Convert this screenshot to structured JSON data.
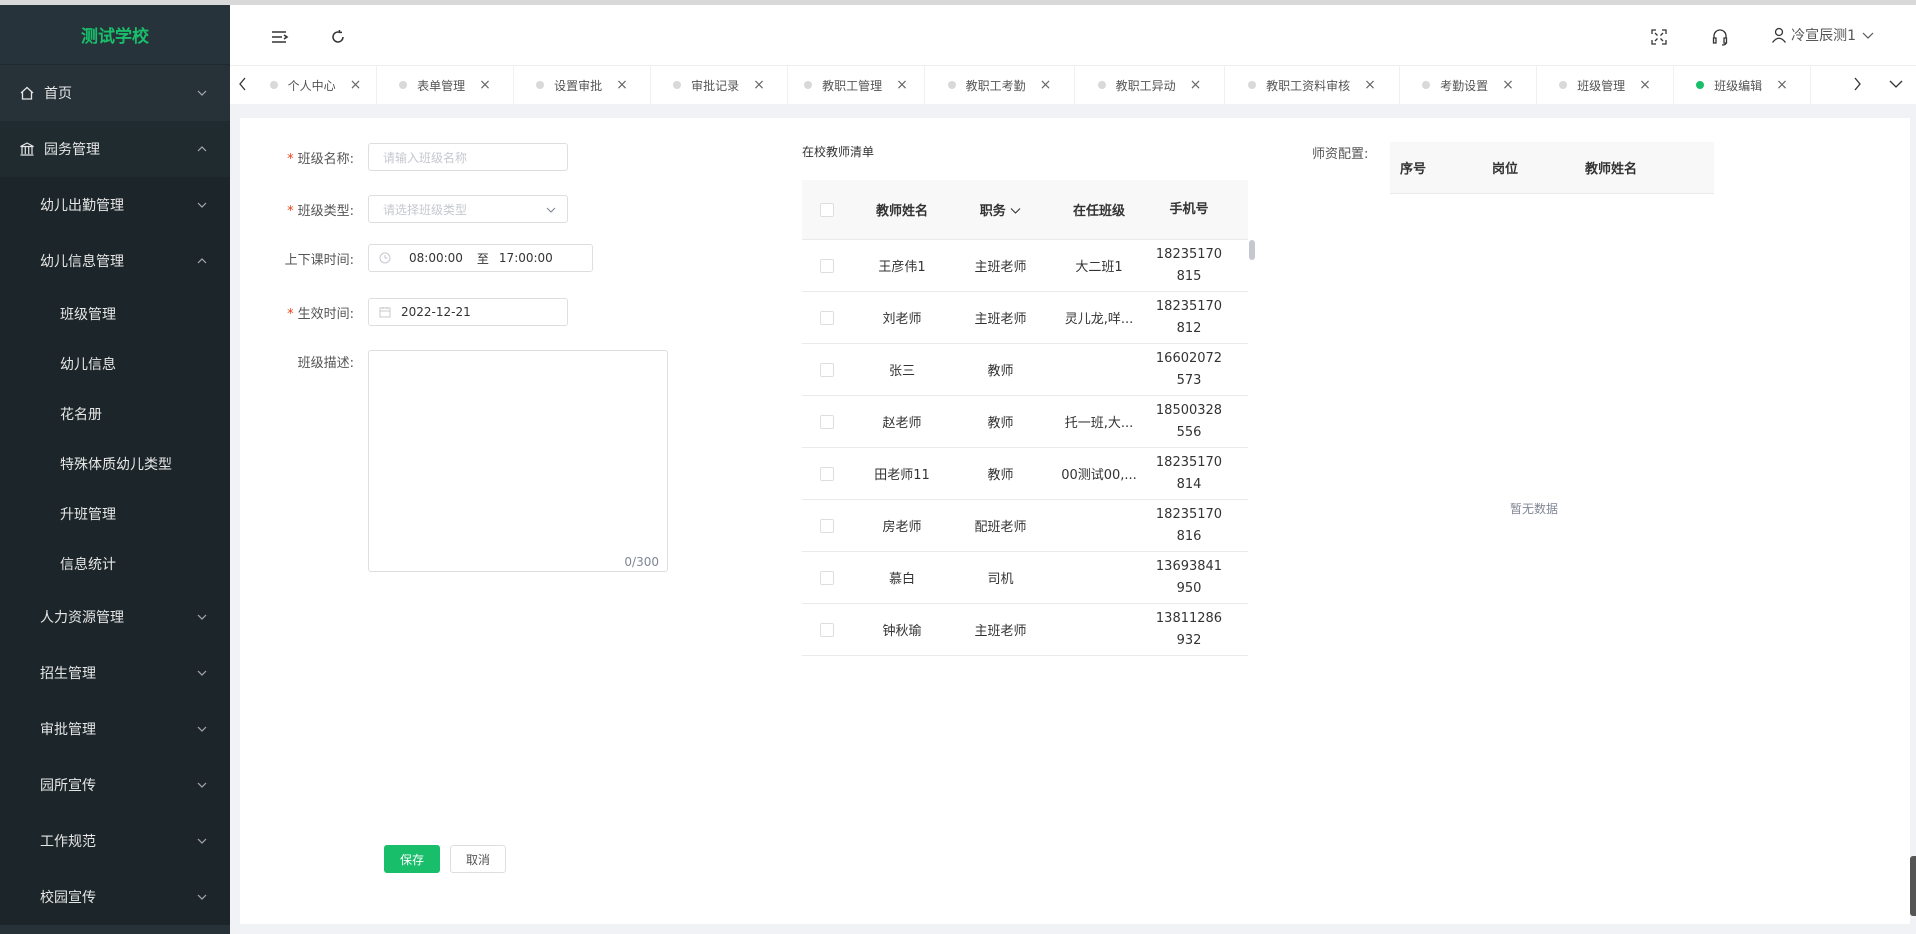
{
  "app": {
    "school_name": "测试学校"
  },
  "sidebar": {
    "items": [
      {
        "label": "首页"
      },
      {
        "label": "园务管理"
      },
      {
        "label": "幼儿出勤管理"
      },
      {
        "label": "幼儿信息管理"
      },
      {
        "label": "班级管理"
      },
      {
        "label": "幼儿信息"
      },
      {
        "label": "花名册"
      },
      {
        "label": "特殊体质幼儿类型"
      },
      {
        "label": "升班管理"
      },
      {
        "label": "信息统计"
      },
      {
        "label": "人力资源管理"
      },
      {
        "label": "招生管理"
      },
      {
        "label": "审批管理"
      },
      {
        "label": "园所宣传"
      },
      {
        "label": "工作规范"
      },
      {
        "label": "校园宣传"
      }
    ]
  },
  "header": {
    "user_name": "冷宣辰测1"
  },
  "tabs": [
    {
      "label": "个人中心"
    },
    {
      "label": "表单管理"
    },
    {
      "label": "设置审批"
    },
    {
      "label": "审批记录"
    },
    {
      "label": "教职工管理"
    },
    {
      "label": "教职工考勤"
    },
    {
      "label": "教职工异动"
    },
    {
      "label": "教职工资料审核"
    },
    {
      "label": "考勤设置"
    },
    {
      "label": "班级管理"
    },
    {
      "label": "班级编辑"
    }
  ],
  "tab_close": "×",
  "form": {
    "class_name": {
      "label": "班级名称:",
      "placeholder": "请输入班级名称"
    },
    "class_type": {
      "label": "班级类型:",
      "placeholder": "请选择班级类型"
    },
    "class_time": {
      "label": "上下课时间:",
      "start": "08:00:00",
      "sep": "至",
      "end": "17:00:00"
    },
    "effective": {
      "label": "生效时间:",
      "value": "2022-12-21"
    },
    "desc": {
      "label": "班级描述:",
      "count": "0/300"
    },
    "required_mark": "*",
    "save": "保存",
    "cancel": "取消"
  },
  "teachers": {
    "title": "在校教师清单",
    "headers": {
      "name": "教师姓名",
      "duty": "职务",
      "cls": "在任班级",
      "phone": "手机号"
    },
    "rows": [
      {
        "name": "王彦伟1",
        "duty": "主班老师",
        "cls": "大二班1",
        "phone": "18235170815"
      },
      {
        "name": "刘老师",
        "duty": "主班老师",
        "cls": "灵儿龙,咩...",
        "phone": "18235170812"
      },
      {
        "name": "张三",
        "duty": "教师",
        "cls": "",
        "phone": "16602072573"
      },
      {
        "name": "赵老师",
        "duty": "教师",
        "cls": "托一班,大...",
        "phone": "18500328556"
      },
      {
        "name": "田老师11",
        "duty": "教师",
        "cls": "00测试00,...",
        "phone": "18235170814"
      },
      {
        "name": "房老师",
        "duty": "配班老师",
        "cls": "",
        "phone": "18235170816"
      },
      {
        "name": "慕白",
        "duty": "司机",
        "cls": "",
        "phone": "13693841950"
      },
      {
        "name": "钟秋瑜",
        "duty": "主班老师",
        "cls": "",
        "phone": "13811286932"
      }
    ]
  },
  "staff": {
    "label": "师资配置:",
    "headers": {
      "no": "序号",
      "post": "岗位",
      "name": "教师姓名"
    },
    "empty": "暂无数据"
  },
  "colors": {
    "accent": "#19be6b",
    "sidebar_bg": "#263238",
    "required": "#ed4014"
  }
}
